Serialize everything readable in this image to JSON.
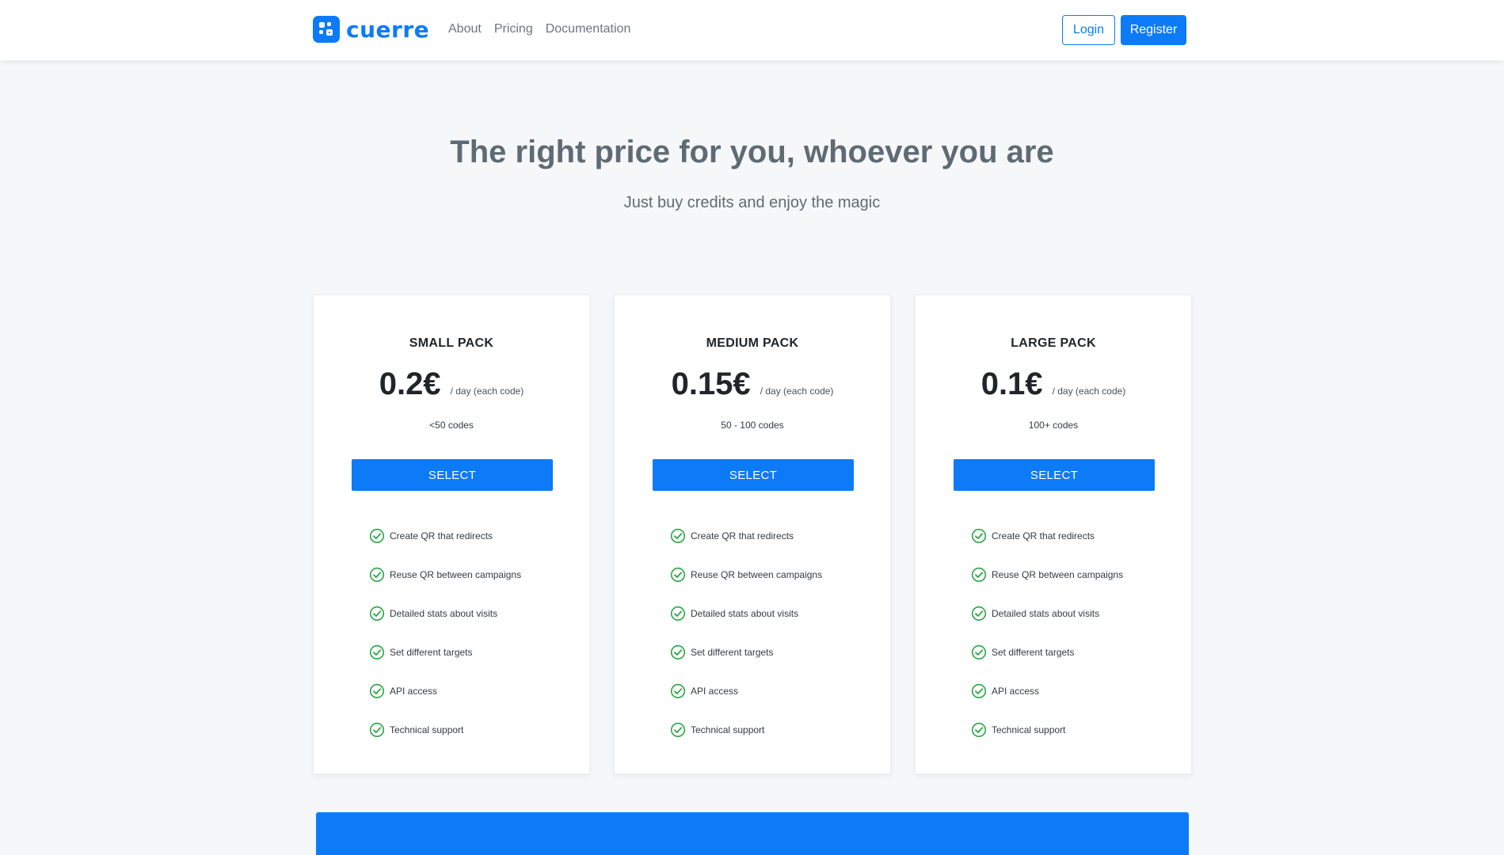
{
  "brand": {
    "name": "cuerre",
    "logo_icon": "qr-logo-icon",
    "color": "#0d7bf7"
  },
  "nav": {
    "links": [
      "About",
      "Pricing",
      "Documentation"
    ],
    "login_label": "Login",
    "register_label": "Register"
  },
  "hero": {
    "title": "The right price for you, whoever you are",
    "subtitle": "Just buy credits and enjoy the magic"
  },
  "plans": [
    {
      "title": "SMALL PACK",
      "price": "0.2€",
      "period": "/ day (each code)",
      "range": "<50 codes",
      "button_label": "SELECT",
      "features": [
        "Create QR that redirects",
        "Reuse QR between campaigns",
        "Detailed stats about visits",
        "Set different targets",
        "API access",
        "Technical support"
      ]
    },
    {
      "title": "MEDIUM PACK",
      "price": "0.15€",
      "period": "/ day (each code)",
      "range": "50 - 100 codes",
      "button_label": "SELECT",
      "features": [
        "Create QR that redirects",
        "Reuse QR between campaigns",
        "Detailed stats about visits",
        "Set different targets",
        "API access",
        "Technical support"
      ]
    },
    {
      "title": "LARGE PACK",
      "price": "0.1€",
      "period": "/ day (each code)",
      "range": "100+ codes",
      "button_label": "SELECT",
      "features": [
        "Create QR that redirects",
        "Reuse QR between campaigns",
        "Detailed stats about visits",
        "Set different targets",
        "API access",
        "Technical support"
      ]
    }
  ],
  "colors": {
    "primary": "#0d7bf7",
    "check": "#28a745",
    "background": "#f6f7f8",
    "heading": "#5f6b74"
  },
  "icons": {
    "feature": "check-circle-icon"
  }
}
